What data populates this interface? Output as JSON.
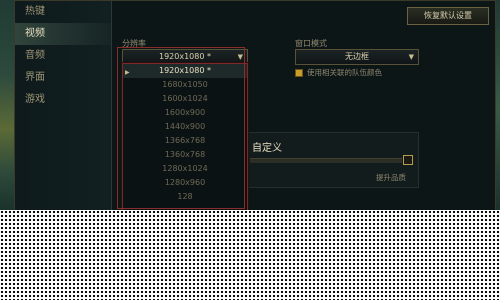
{
  "sidebar": {
    "items": [
      {
        "label": "热键",
        "active": false
      },
      {
        "label": "视频",
        "active": true
      },
      {
        "label": "音频",
        "active": false
      },
      {
        "label": "界面",
        "active": false
      },
      {
        "label": "游戏",
        "active": false
      }
    ]
  },
  "header": {
    "restore_defaults_label": "恢复默认设置"
  },
  "resolution": {
    "label": "分辨率",
    "value": "1920x1080 *",
    "options": [
      "1920x1080 *",
      "1680x1050",
      "1600x1024",
      "1600x900",
      "1440x900",
      "1366x768",
      "1360x768",
      "1280x1024",
      "1280x960",
      "128"
    ],
    "selected_index": 0
  },
  "window_mode": {
    "label": "窗口模式",
    "value": "无边框",
    "colorblind_label": "使用相关联的队伍颜色",
    "colorblind_checked": true
  },
  "custom_panel": {
    "title": "自定义",
    "link_label": "提升品质"
  },
  "colors": {
    "accent_gold": "#c99d2a",
    "highlight_red": "#8a2c2c"
  }
}
